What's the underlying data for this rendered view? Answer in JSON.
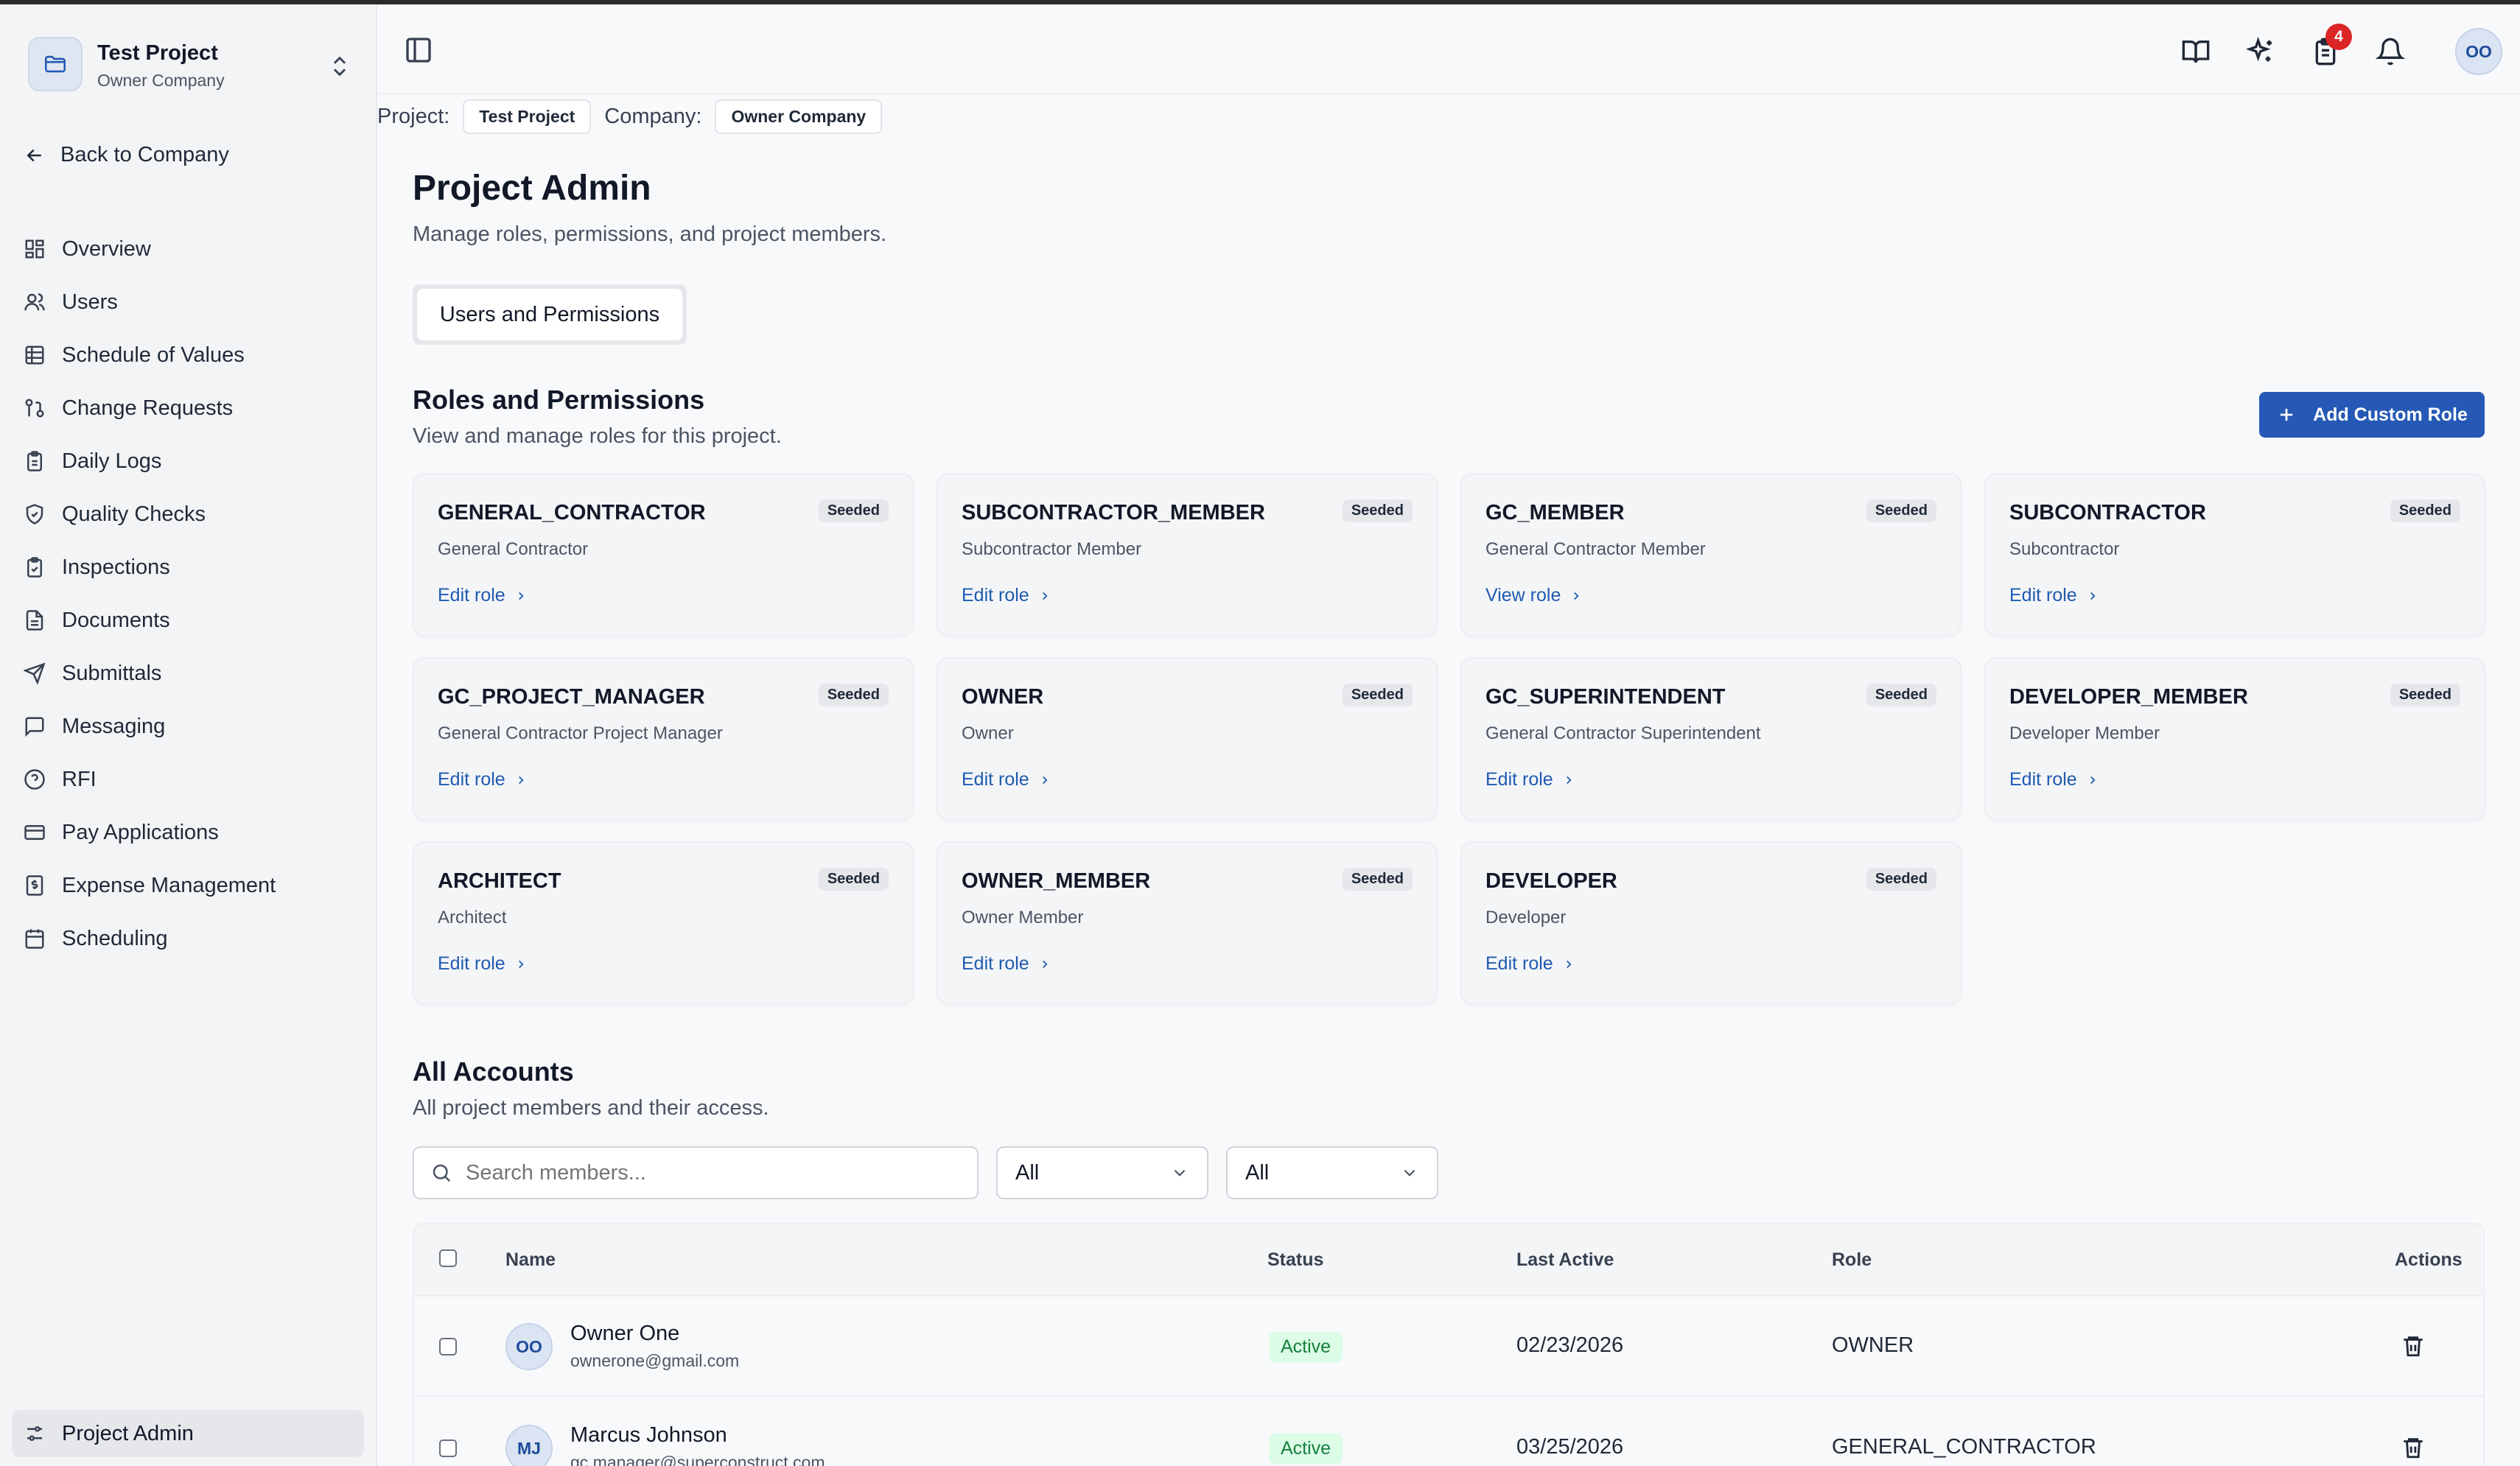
{
  "project": {
    "name": "Test Project",
    "company": "Owner Company"
  },
  "sidebar": {
    "back_label": "Back to Company",
    "items": [
      {
        "label": "Overview",
        "icon": "grid-icon"
      },
      {
        "label": "Users",
        "icon": "users-icon"
      },
      {
        "label": "Schedule of Values",
        "icon": "table-icon"
      },
      {
        "label": "Change Requests",
        "icon": "git-pull-request-icon"
      },
      {
        "label": "Daily Logs",
        "icon": "clipboard-icon"
      },
      {
        "label": "Quality Checks",
        "icon": "shield-check-icon"
      },
      {
        "label": "Inspections",
        "icon": "clipboard-check-icon"
      },
      {
        "label": "Documents",
        "icon": "file-text-icon"
      },
      {
        "label": "Submittals",
        "icon": "send-icon"
      },
      {
        "label": "Messaging",
        "icon": "message-square-icon"
      },
      {
        "label": "RFI",
        "icon": "help-circle-icon"
      },
      {
        "label": "Pay Applications",
        "icon": "credit-card-icon"
      },
      {
        "label": "Expense Management",
        "icon": "receipt-icon"
      },
      {
        "label": "Scheduling",
        "icon": "calendar-icon"
      }
    ],
    "active_item": {
      "label": "Project Admin",
      "icon": "sliders-icon"
    }
  },
  "header": {
    "notification_count": "4",
    "user_initials": "OO"
  },
  "context": {
    "project_label": "Project:",
    "project_value": "Test Project",
    "company_label": "Company:",
    "company_value": "Owner Company"
  },
  "page": {
    "title": "Project Admin",
    "subtitle": "Manage roles, permissions, and project members.",
    "tab_active": "Users and Permissions"
  },
  "roles_section": {
    "title": "Roles and Permissions",
    "subtitle": "View and manage roles for this project.",
    "add_button": "Add Custom Role",
    "cards": [
      {
        "name": "GENERAL_CONTRACTOR",
        "badge": "Seeded",
        "desc": "General Contractor",
        "link": "Edit role"
      },
      {
        "name": "SUBCONTRACTOR_MEMBER",
        "badge": "Seeded",
        "desc": "Subcontractor Member",
        "link": "Edit role"
      },
      {
        "name": "GC_MEMBER",
        "badge": "Seeded",
        "desc": "General Contractor Member",
        "link": "View role"
      },
      {
        "name": "SUBCONTRACTOR",
        "badge": "Seeded",
        "desc": "Subcontractor",
        "link": "Edit role"
      },
      {
        "name": "GC_PROJECT_MANAGER",
        "badge": "Seeded",
        "desc": "General Contractor Project Manager",
        "link": "Edit role"
      },
      {
        "name": "OWNER",
        "badge": "Seeded",
        "desc": "Owner",
        "link": "Edit role"
      },
      {
        "name": "GC_SUPERINTENDENT",
        "badge": "Seeded",
        "desc": "General Contractor Superintendent",
        "link": "Edit role"
      },
      {
        "name": "DEVELOPER_MEMBER",
        "badge": "Seeded",
        "desc": "Developer Member",
        "link": "Edit role"
      },
      {
        "name": "ARCHITECT",
        "badge": "Seeded",
        "desc": "Architect",
        "link": "Edit role"
      },
      {
        "name": "OWNER_MEMBER",
        "badge": "Seeded",
        "desc": "Owner Member",
        "link": "Edit role"
      },
      {
        "name": "DEVELOPER",
        "badge": "Seeded",
        "desc": "Developer",
        "link": "Edit role"
      }
    ]
  },
  "accounts_section": {
    "title": "All Accounts",
    "subtitle": "All project members and their access.",
    "search_placeholder": "Search members...",
    "filter1": "All",
    "filter2": "All",
    "columns": {
      "name": "Name",
      "status": "Status",
      "last_active": "Last Active",
      "role": "Role",
      "actions": "Actions"
    },
    "rows": [
      {
        "initials": "OO",
        "name": "Owner One",
        "email": "ownerone@gmail.com",
        "status": "Active",
        "last_active": "02/23/2026",
        "role": "OWNER"
      },
      {
        "initials": "MJ",
        "name": "Marcus Johnson",
        "email": "gc.manager@superconstruct.com",
        "status": "Active",
        "last_active": "03/25/2026",
        "role": "GENERAL_CONTRACTOR"
      }
    ]
  },
  "colors": {
    "primary": "#2559b5",
    "link": "#1f5bb0",
    "badge_red": "#dc2626",
    "active_green": "#15803d"
  }
}
